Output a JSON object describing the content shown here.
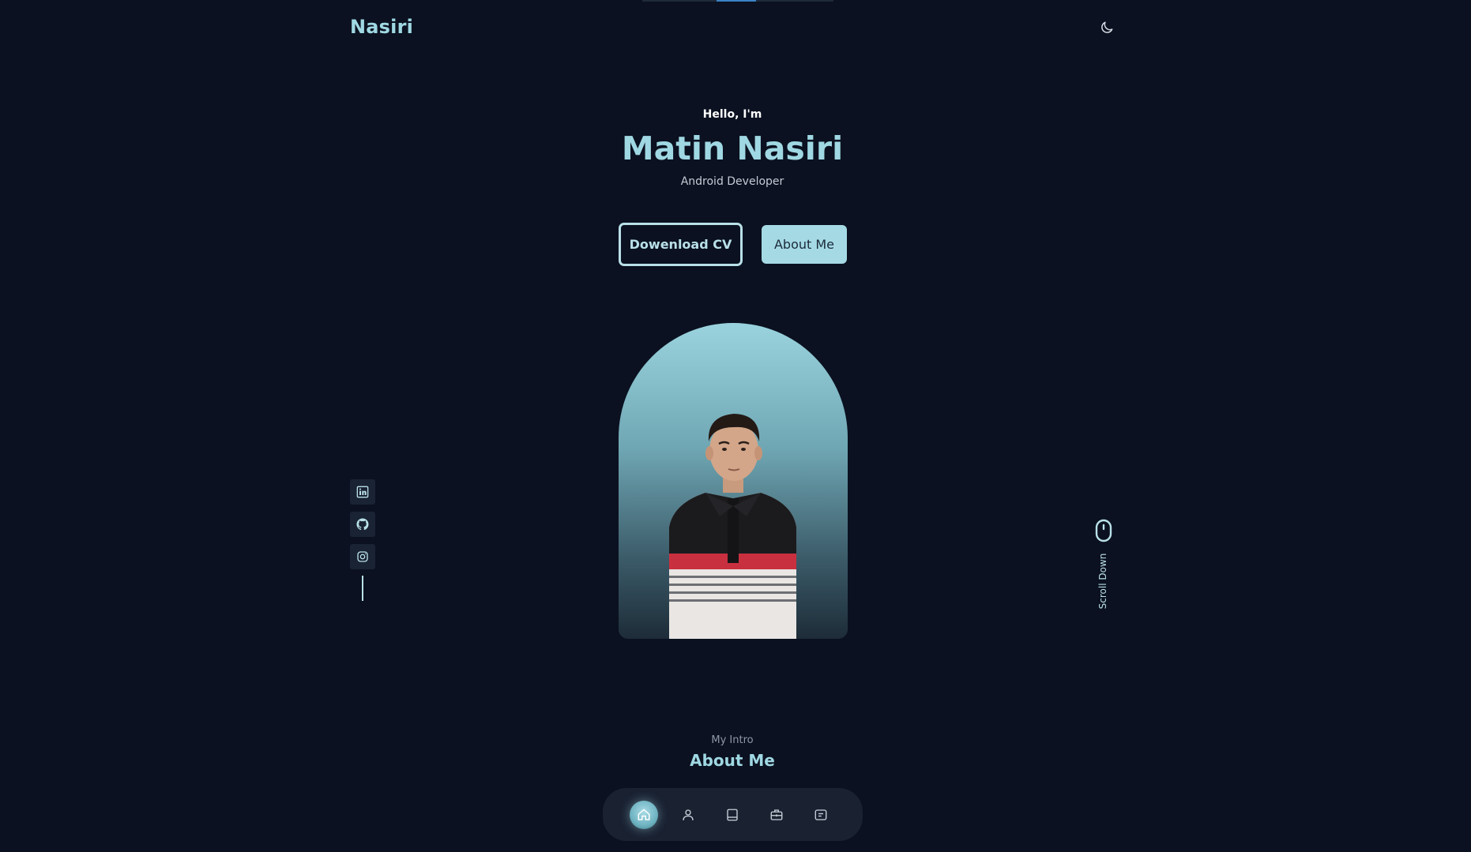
{
  "header": {
    "logo": "Nasiri",
    "theme_toggle_icon": "moon-icon"
  },
  "hero": {
    "greeting": "Hello, I'm",
    "name": "Matin Nasiri",
    "role": "Android Developer",
    "download_cv_label": "Dowenload CV",
    "about_me_label": "About Me",
    "portrait_icon": "profile-photo"
  },
  "social": {
    "items": [
      {
        "icon": "linkedin-icon"
      },
      {
        "icon": "github-icon"
      },
      {
        "icon": "instagram-icon"
      }
    ]
  },
  "scroll": {
    "label": "Scroll Down",
    "icon": "mouse-icon"
  },
  "section": {
    "subtitle": "My Intro",
    "title": "About Me"
  },
  "bottom_nav": {
    "items": [
      {
        "icon": "home-icon",
        "active": true
      },
      {
        "icon": "user-icon",
        "active": false
      },
      {
        "icon": "book-icon",
        "active": false
      },
      {
        "icon": "briefcase-icon",
        "active": false
      },
      {
        "icon": "message-icon",
        "active": false
      }
    ]
  },
  "colors": {
    "background": "#0b1120",
    "accent": "#9fd8e3",
    "button_solid": "#a5dae5",
    "nav_background": "#1a2232"
  }
}
